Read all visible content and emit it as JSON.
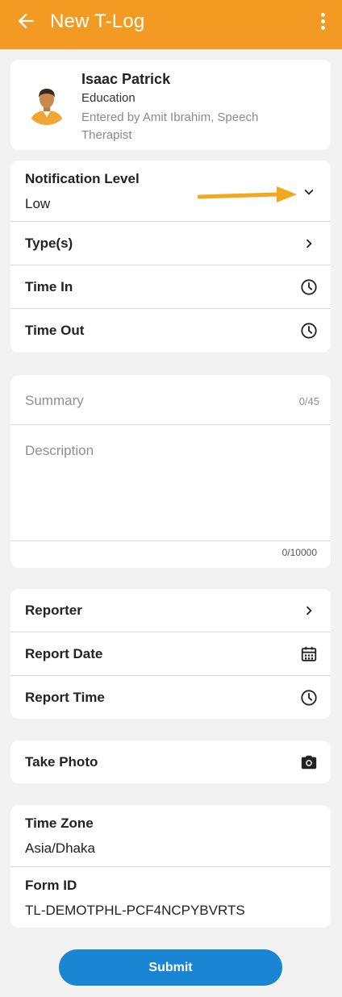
{
  "appbar": {
    "title": "New T-Log",
    "back_icon": "arrow-left-icon",
    "menu_icon": "more-vert-icon",
    "color": "#f39a22"
  },
  "profile": {
    "name": "Isaac Patrick",
    "department": "Education",
    "entered_by": "Entered by Amit Ibrahim, Speech Therapist"
  },
  "details": {
    "notification_level": {
      "label": "Notification Level",
      "value": "Low",
      "icon": "chevron-down-icon"
    },
    "types": {
      "label": "Type(s)",
      "icon": "chevron-right-icon"
    },
    "time_in": {
      "label": "Time In",
      "icon": "clock-icon"
    },
    "time_out": {
      "label": "Time Out",
      "icon": "clock-icon"
    }
  },
  "summary": {
    "placeholder": "Summary",
    "counter": "0/45"
  },
  "description": {
    "placeholder": "Description",
    "counter": "0/10000"
  },
  "report": {
    "reporter": {
      "label": "Reporter",
      "icon": "chevron-right-icon"
    },
    "report_date": {
      "label": "Report Date",
      "icon": "calendar-icon"
    },
    "report_time": {
      "label": "Report Time",
      "icon": "clock-icon"
    }
  },
  "photo": {
    "label": "Take Photo",
    "icon": "camera-icon"
  },
  "meta": {
    "time_zone": {
      "label": "Time Zone",
      "value": "Asia/Dhaka"
    },
    "form_id": {
      "label": "Form ID",
      "value": "TL-DEMOTPHL-PCF4NCPYBVRTS"
    }
  },
  "submit": {
    "label": "Submit",
    "color": "#1a86d3"
  },
  "annotation_arrow_color": "#f2a81d"
}
